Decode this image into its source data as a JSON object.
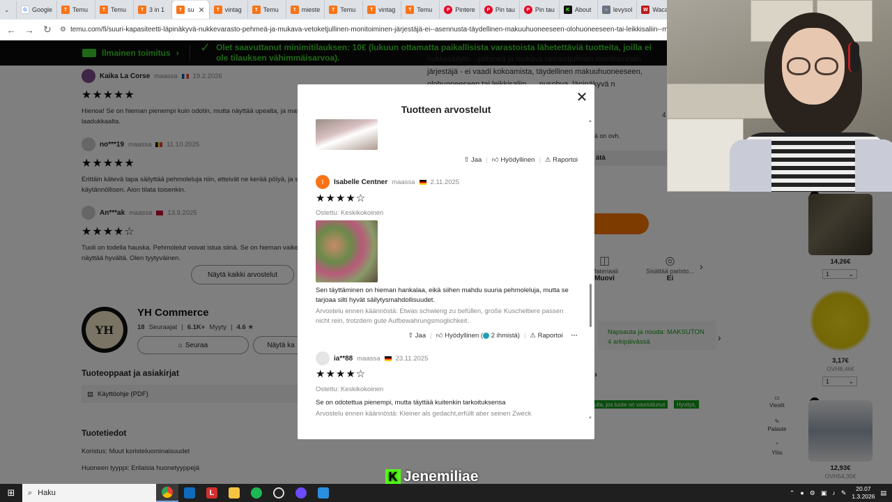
{
  "browser": {
    "tabs": [
      {
        "label": "Google",
        "icon": "google-icon"
      },
      {
        "label": "Temu",
        "icon": "temu-icon"
      },
      {
        "label": "Temu",
        "icon": "temu-icon"
      },
      {
        "label": "3 in 1",
        "icon": "temu-icon"
      },
      {
        "label": "su",
        "icon": "temu-icon",
        "active": true
      },
      {
        "label": "vintag",
        "icon": "temu-icon"
      },
      {
        "label": "Temu",
        "icon": "temu-icon"
      },
      {
        "label": "mieste",
        "icon": "temu-icon"
      },
      {
        "label": "Temu",
        "icon": "temu-icon"
      },
      {
        "label": "vintag",
        "icon": "temu-icon"
      },
      {
        "label": "Temu",
        "icon": "temu-icon"
      },
      {
        "label": "Pintere",
        "icon": "pinterest-icon"
      },
      {
        "label": "Pin tau",
        "icon": "pinterest-icon"
      },
      {
        "label": "Pin tau",
        "icon": "pinterest-icon"
      },
      {
        "label": "About",
        "icon": "kick-icon"
      },
      {
        "label": "levysol",
        "icon": "globe-icon"
      },
      {
        "label": "Waca",
        "icon": "waca-icon"
      }
    ],
    "url": "temu.com/fi/suuri-kapasiteetti-läpinäkyvä-nukkevarasto-pehmeä-ja-mukava-vetoketjullinen-monitoiminen-järjestäjä-ei--asennusta-täydellinen-makuuhuoneeseen-olohuoneeseen-tai-leikkisaliin--muotoilu-ke"
  },
  "banner": {
    "shipping": "Ilmainen toimitus",
    "message": "Olet saavuttanut minimitilauksen: 10€ (lukuun ottamatta paikallisista varastoista lähetettäviä tuotteita, joilla ei ole tilauksen vähimmäisarvoa)."
  },
  "reviews_bg": [
    {
      "name": "Kaika La Corse",
      "country_prefix": "maassa",
      "date": "19.2.2026",
      "stars": "★★★★★",
      "text": "Hienoa! Se on hieman pienempi kuin odotin, mutta näyttää upealta, ja mate",
      "text2": "laadukkaalta."
    },
    {
      "name": "no***19",
      "country_prefix": "maassa",
      "date": "11.10.2025",
      "stars": "★★★★★",
      "text": "Erittäin kätevä tapa säilyttää pehmoleluja niin, etteivät ne kerää pölyä, ja se",
      "text2": "käytännöllisen. Aion tilata toisenkin."
    },
    {
      "name": "An***ak",
      "country_prefix": "maassa",
      "date": "13.9.2025",
      "stars": "★★★★☆",
      "text": "Tuoli on todella hauska. Pehmolelut voivat istua siinä. Se on hieman vaikea",
      "text2": "näyttää hyvältä. Olen tyytyväinen."
    }
  ],
  "show_all_label": "Näytä kaikki arvostelut",
  "store": {
    "logo_text": "YH",
    "logo_sub": "Commerce",
    "name": "YH Commerce",
    "followers": "18",
    "followers_label": "Seuraajat",
    "sold": "6.1K+",
    "sold_label": "Myyty",
    "rating": "4.6 ★",
    "follow_label": "Seuraa",
    "visit_label": "Näytä ka"
  },
  "guides_title": "Tuoteoppaat ja asiakirjat",
  "manual_label": "Käyttöohje (PDF)",
  "product_info_title": "Tuotetiedot",
  "product_info": [
    "Koristus: Muut koristeluominaisuudet",
    "Huoneen tyyppi: Erilaisia huonetyyppejä"
  ],
  "right_desc": "nukkesäilytin - pehmeä ja mukava vetoketjullinen monitoiminen järjestäjä - ei vaadi kokoamista, täydellinen makuuhuoneeseen, olohuoneeseen tai leikkisaliin, ... pusohva, läpinäkyvä n",
  "right_misc": {
    "vat": "ä on ovh.",
    "deliver": "ätä",
    "num": "4"
  },
  "features": [
    {
      "label": "Materiaali",
      "value": "Muovi"
    },
    {
      "label": "Sisältää paristo...",
      "value": "Ei"
    }
  ],
  "pickup": "Napsauta ja nouda: MAKSUTON 4 arkipäivässä",
  "green_tags": [
    "ulta, jos tuote on vaurioitunut",
    "Hyvitys,"
  ],
  "products": [
    {
      "price": "14,26€",
      "qty": "1"
    },
    {
      "price": "3,17€",
      "old": "OVH8,46€",
      "qty": "1"
    },
    {
      "price": "12,93€",
      "old": "OVH54,35€"
    }
  ],
  "side_tools": [
    {
      "label": "Viestit",
      "icon": "chat-icon"
    },
    {
      "label": "Palaute",
      "icon": "feedback-icon"
    },
    {
      "label": "Ylös",
      "icon": "up-icon"
    }
  ],
  "modal": {
    "title": "Tuotteen arvostelut",
    "actions": {
      "share": "Jaa",
      "helpful": "Hyödyllinen",
      "report": "Raportoi"
    },
    "review1": {
      "avatar": "I",
      "name": "Isabelle Centner",
      "country_prefix": "maassa",
      "date": "2.11.2025",
      "stars": "★★★★☆",
      "purchased": "Ostettu: Keskikokoinen",
      "text": "Sen täyttäminen on hieman hankalaa, eikä siihen mahdu suuria pehmoleluja, mutta se tarjoaa silti hyvät säilytysmahdollisuudet.",
      "translation": "Arvostelu ennen käännöstä: Etwas schwierig zu befüllen, große Kuscheltiere passen nicht rein, trotzdem gute Aufbewahrungsmoglichkeit.",
      "helpful_count": "2 ihmistä"
    },
    "review2": {
      "name": "ia**88",
      "country_prefix": "maassa",
      "date": "23.11.2025",
      "stars": "★★★★☆",
      "purchased": "Ostettu: Keskikokoinen",
      "text": "Se on odotettua pienempi, mutta täyttää kuitenkin tarkoituksensa",
      "translation": "Arvostelu ennen käännöstä: Kleiner als gedacht,erfüllt aber seinen Zweck"
    }
  },
  "streamer": {
    "name": "Jenemiliae"
  },
  "taskbar": {
    "search_placeholder": "Haku",
    "time": "20.07",
    "date": "1.3.2026"
  }
}
